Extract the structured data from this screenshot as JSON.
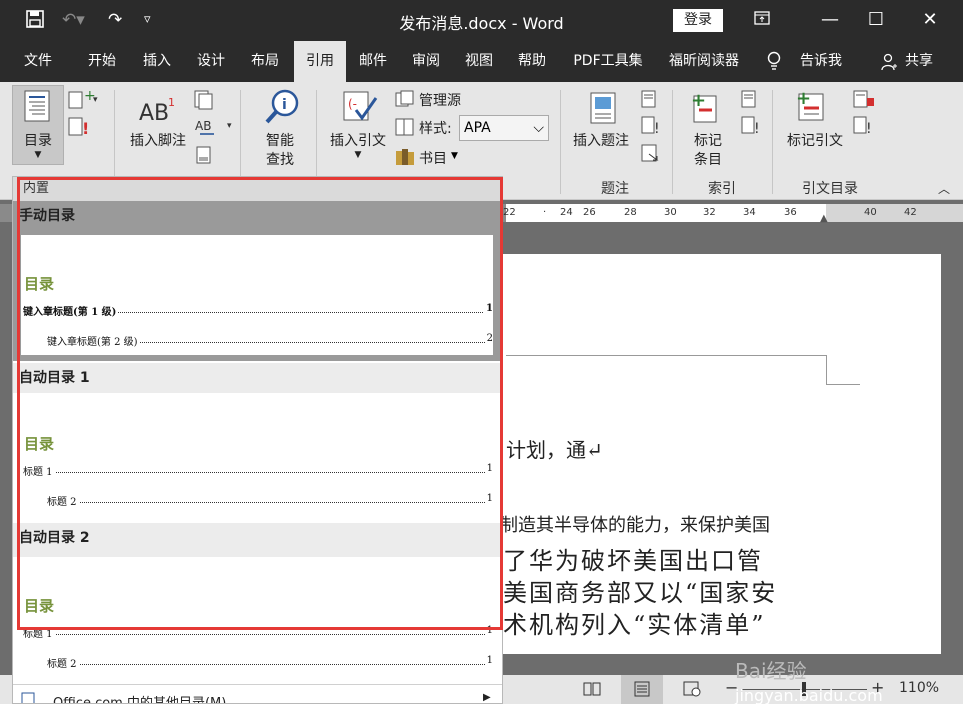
{
  "titlebar": {
    "title": "发布消息.docx  -  Word",
    "login": "登录"
  },
  "menu": {
    "items": [
      "文件",
      "开始",
      "插入",
      "设计",
      "布局",
      "引用",
      "邮件",
      "审阅",
      "视图",
      "帮助",
      "PDF工具集",
      "福昕阅读器",
      "告诉我",
      "共享"
    ],
    "active": "引用"
  },
  "ribbon": {
    "toc_label": "目录",
    "insert_footnote": "插入脚注",
    "smart_lookup_1": "智能",
    "smart_lookup_2": "查找",
    "insert_citation": "插入引文",
    "manage_sources": "管理源",
    "style_label": "样式:",
    "style_value": "APA",
    "bibliography": "书目",
    "insert_caption": "插入题注",
    "mark_entry_1": "标记",
    "mark_entry_2": "条目",
    "mark_citation": "标记引文",
    "group_captions": "题注",
    "group_index": "索引",
    "group_authorities": "引文目录"
  },
  "ruler": {
    "ticks": [
      "22",
      "24",
      "26",
      "28",
      "30",
      "32",
      "34",
      "36",
      "40",
      "42"
    ]
  },
  "panel": {
    "header": "内置",
    "sections": [
      {
        "title": "手动目录",
        "heading": "目录",
        "rows": [
          {
            "label": "键入章标题(第 1 级)",
            "num": "1",
            "bold": true
          },
          {
            "label": "键入章标题(第 2 级)",
            "num": "2",
            "bold": false
          }
        ]
      },
      {
        "title": "自动目录 1",
        "heading": "目录",
        "rows": [
          {
            "label": "标题 1",
            "num": "1",
            "bold": true
          },
          {
            "label": "标题 2",
            "num": "1",
            "bold": false
          }
        ]
      },
      {
        "title": "自动目录 2",
        "heading": "目录",
        "rows": [
          {
            "label": "标题 1",
            "num": "1",
            "bold": true
          },
          {
            "label": "标题 2",
            "num": "1",
            "bold": false
          }
        ]
      }
    ],
    "more": "Office.com 中的其他目录(M)"
  },
  "document": {
    "line1": "计划，通↵",
    "line2": "制造其半导体的能力，来保护美国",
    "line3": "了华为破坏美国出口管",
    "line4": "美国商务部又以“国家安",
    "line5": "术机构列入“实体清单”"
  },
  "statusbar": {
    "zoom": "110%"
  },
  "watermark": {
    "text1": "Bai经验",
    "text2": "jingyan.baidu.com"
  },
  "colors": {
    "titlebar": "#2b2b2b",
    "highlight": "#e53935",
    "toc_heading": "#77933c"
  }
}
